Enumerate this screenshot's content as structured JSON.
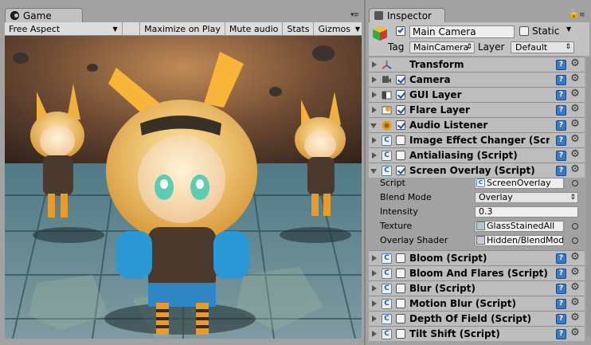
{
  "game_panel": {
    "tab_title": "Game",
    "toolbar": {
      "aspect": "Free Aspect",
      "maximize_on_play": "Maximize on Play",
      "mute_audio": "Mute audio",
      "stats": "Stats",
      "gizmos": "Gizmos"
    }
  },
  "inspector": {
    "tab_title": "Inspector",
    "object": {
      "name": "Main Camera",
      "static_label": "Static",
      "tag_label": "Tag",
      "tag_value": "MainCamera",
      "layer_label": "Layer",
      "layer_value": "Default"
    },
    "components": [
      {
        "label": "Transform",
        "enabled": null,
        "icon": "transform-icon"
      },
      {
        "label": "Camera",
        "enabled": true,
        "icon": "camera-icon"
      },
      {
        "label": "GUI Layer",
        "enabled": true,
        "icon": "gui-layer-icon"
      },
      {
        "label": "Flare Layer",
        "enabled": true,
        "icon": "flare-layer-icon"
      },
      {
        "label": "Audio Listener",
        "enabled": true,
        "icon": "audio-listener-icon"
      },
      {
        "label": "Image Effect Changer (Script)",
        "enabled": false,
        "icon": "script-icon"
      },
      {
        "label": "Antialiasing (Script)",
        "enabled": false,
        "icon": "script-icon"
      },
      {
        "label": "Screen Overlay (Script)",
        "enabled": true,
        "icon": "script-icon"
      },
      {
        "label": "Bloom (Script)",
        "enabled": false,
        "icon": "script-icon"
      },
      {
        "label": "Bloom And Flares (Script)",
        "enabled": false,
        "icon": "script-icon"
      },
      {
        "label": "Blur (Script)",
        "enabled": false,
        "icon": "script-icon"
      },
      {
        "label": "Motion Blur (Script)",
        "enabled": false,
        "icon": "script-icon"
      },
      {
        "label": "Depth Of Field (Script)",
        "enabled": false,
        "icon": "script-icon"
      },
      {
        "label": "Tilt Shift (Script)",
        "enabled": false,
        "icon": "script-icon"
      }
    ],
    "screen_overlay": {
      "script_label": "Script",
      "script_value": "ScreenOverlay",
      "blend_mode_label": "Blend Mode",
      "blend_mode_value": "Overlay",
      "intensity_label": "Intensity",
      "intensity_value": "0.3",
      "texture_label": "Texture",
      "texture_value": "GlassStainedAll",
      "shader_label": "Overlay Shader",
      "shader_value": "Hidden/BlendModesOverlay"
    }
  },
  "colors": {
    "panel_bg": "#a2a2a2",
    "header_bg": "#bdbdbd",
    "help_blue": "#3c79c2"
  }
}
